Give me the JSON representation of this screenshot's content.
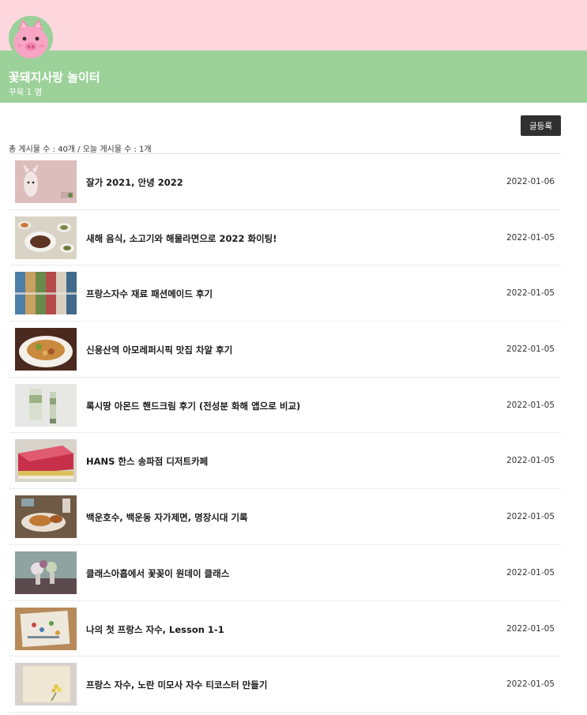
{
  "cafe": {
    "title": "꽃돼지사랑 놀이터",
    "members": "꾸욱 1 명"
  },
  "toolbar": {
    "write_label": "글등록"
  },
  "stats": "총 게시물 수 : 40개 / 오늘 게시물 수 : 1개",
  "posts": [
    {
      "title": "잘가 2021, 안녕 2022",
      "date": "2022-01-06"
    },
    {
      "title": "새해 음식, 소고기와 해물라면으로 2022 화이팅!",
      "date": "2022-01-05"
    },
    {
      "title": "프랑스자수 재료 패션메이드 후기",
      "date": "2022-01-05"
    },
    {
      "title": "신용산역 아모레퍼시픽 맛집 차알 후기",
      "date": "2022-01-05"
    },
    {
      "title": "록시땅 아몬드 핸드크림 후기 (전성분 화해 앱으로 비교)",
      "date": "2022-01-05"
    },
    {
      "title": "HANS 한스 송파점 디저트카페",
      "date": "2022-01-05"
    },
    {
      "title": "백운호수, 백운동 자가제면, 명장시대 기록",
      "date": "2022-01-05"
    },
    {
      "title": "클래스아홉에서 꽃꽂이 원데이 클래스",
      "date": "2022-01-05"
    },
    {
      "title": "나의 첫 프랑스 자수, Lesson 1-1",
      "date": "2022-01-05"
    },
    {
      "title": "프랑스 자수, 노란 미모사 자수 티코스터 만들기",
      "date": "2022-01-05"
    }
  ]
}
